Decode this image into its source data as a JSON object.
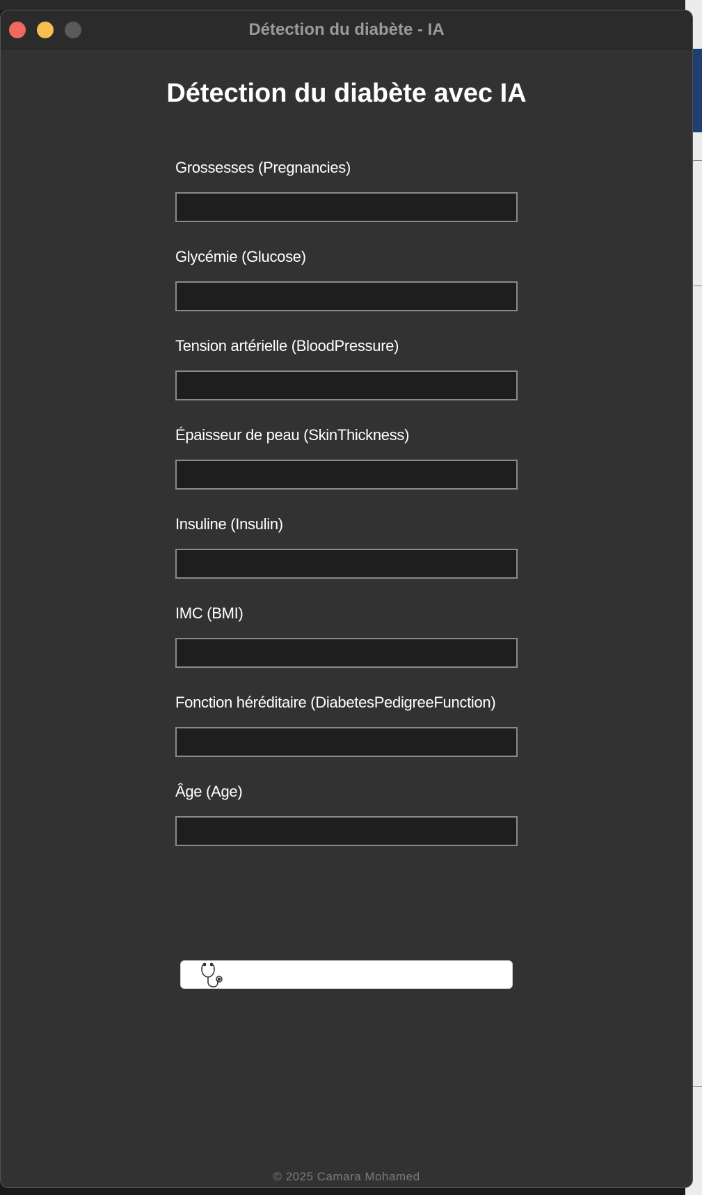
{
  "window": {
    "title": "Détection du diabète - IA"
  },
  "page": {
    "heading": "Détection du diabète avec IA"
  },
  "form": {
    "fields": [
      {
        "label": "Grossesses (Pregnancies)",
        "value": ""
      },
      {
        "label": "Glycémie (Glucose)",
        "value": ""
      },
      {
        "label": "Tension artérielle (BloodPressure)",
        "value": ""
      },
      {
        "label": "Épaisseur de peau (SkinThickness)",
        "value": ""
      },
      {
        "label": "Insuline (Insulin)",
        "value": ""
      },
      {
        "label": "IMC (BMI)",
        "value": ""
      },
      {
        "label": "Fonction héréditaire (DiabetesPedigreeFunction)",
        "value": ""
      },
      {
        "label": "Âge (Age)",
        "value": ""
      }
    ]
  },
  "predict_button": {
    "label": "",
    "icon": "stethoscope-icon"
  },
  "footer": {
    "text": "© 2025 Camara Mohamed"
  },
  "colors": {
    "window_bg": "#323232",
    "titlebar_bg": "#2b2b2b",
    "input_bg": "#1e1e1e",
    "input_border": "#8a8a8a",
    "close": "#ee6a5f",
    "minimize": "#f5be4f",
    "zoom": "#5a5a5a"
  }
}
